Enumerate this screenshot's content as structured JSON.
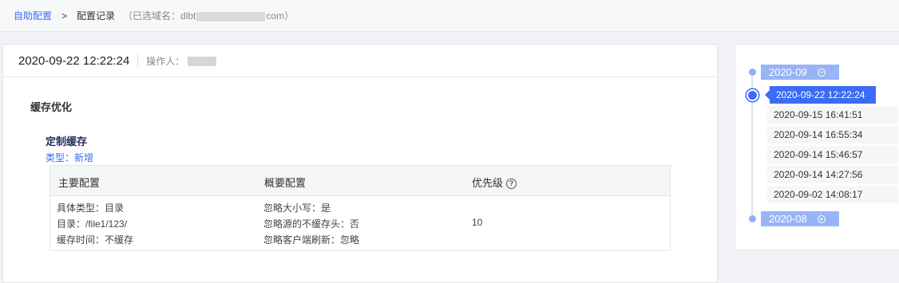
{
  "breadcrumb": {
    "home": "自助配置",
    "separator": ">",
    "current": "配置记录",
    "domain_prefix": "（已选域名：dlbt",
    "domain_suffix": "com）"
  },
  "record": {
    "time": "2020-09-22 12:22:24",
    "operator_label": "操作人："
  },
  "section": {
    "title": "缓存优化",
    "subtitle": "定制缓存",
    "type": "类型：新增"
  },
  "table": {
    "headers": [
      "主要配置",
      "概要配置",
      "优先级"
    ],
    "main_config": [
      "具体类型：目录",
      "目录：/file1/123/",
      "缓存时间：不缓存"
    ],
    "summary_config": [
      "忽略大小写：是",
      "忽略源的不缓存头：否",
      "忽略客户端刷新：忽略"
    ],
    "priority": "10"
  },
  "timeline": {
    "month_open": "2020-09",
    "month_closed": "2020-08",
    "items": [
      "2020-09-22 12:22:24",
      "2020-09-15 16:41:51",
      "2020-09-14 16:55:34",
      "2020-09-14 15:46:57",
      "2020-09-14 14:27:56",
      "2020-09-02 14:08:17"
    ]
  },
  "colors": {
    "accent": "#3a6cf6",
    "month_bg": "#97b4f6",
    "page_bg": "#f0f2f5"
  }
}
